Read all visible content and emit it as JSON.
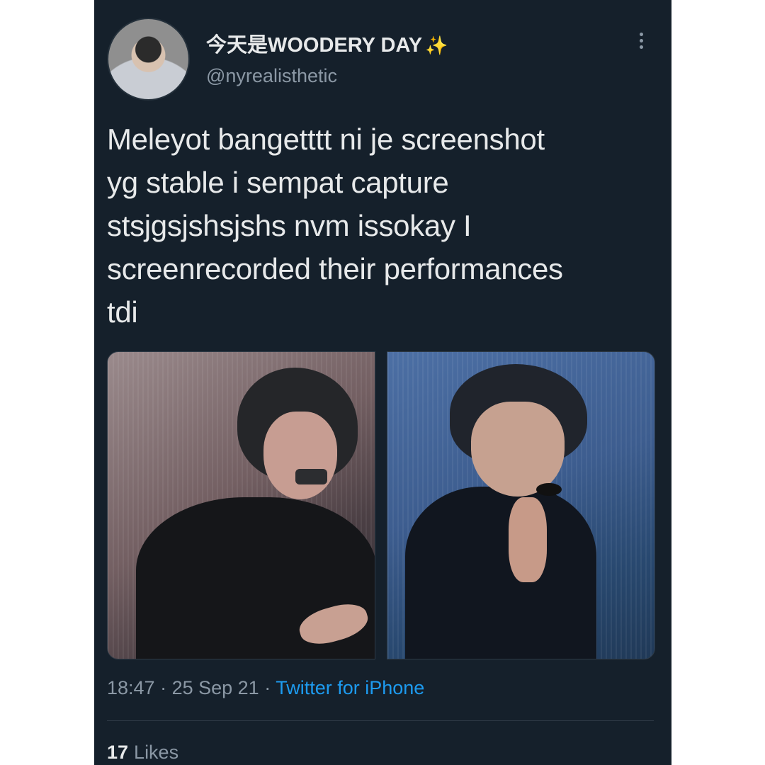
{
  "tweet": {
    "display_name": "今天是WOODERY DAY",
    "handle": "@nyrealisthetic",
    "text": "Meleyot bangetttt ni je screenshot\nyg stable i sempat capture\nstsjgsjshsjshs nvm issokay I\nscreenrecorded their performances\ntdi",
    "meta": {
      "time": "18:47",
      "separator_1": " · ",
      "date": "25 Sep 21",
      "separator_2": " · ",
      "source": "Twitter for iPhone"
    },
    "stats": {
      "likes_count": "17",
      "likes_label": "Likes"
    }
  },
  "icons": {
    "sparkle": "✨",
    "more": "more-icon"
  },
  "colors": {
    "background": "#15202b",
    "primary_text": "#e7e9ea",
    "secondary_text": "#8b98a5",
    "link": "#1d9bf0"
  }
}
